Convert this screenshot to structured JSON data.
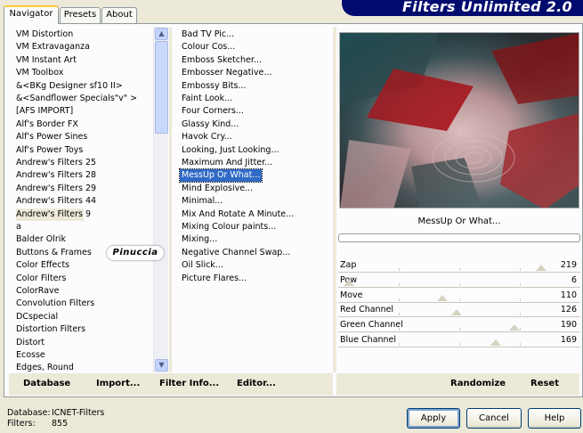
{
  "window": {
    "banner_title": "Filters Unlimited 2.0"
  },
  "tabs": [
    {
      "label": "Navigator",
      "active": true
    },
    {
      "label": "Presets",
      "active": false
    },
    {
      "label": "About",
      "active": false
    }
  ],
  "categories": {
    "selected": "Andrew's Filters 9",
    "items": [
      "VM Distortion",
      "VM Extravaganza",
      "VM Instant Art",
      "VM Toolbox",
      "&<BKg Designer sf10 II>",
      "&<Sandflower Specials\"v\" >",
      "[AFS IMPORT]",
      "Alf's Border FX",
      "Alf's Power Sines",
      "Alf's Power Toys",
      "Andrew's Filters 25",
      "Andrew's Filters 28",
      "Andrew's Filters 29",
      "Andrew's Filters 44",
      "Andrew's Filters 9",
      "a",
      "Balder Olrik",
      "Buttons & Frames",
      "Color Effects",
      "Color Filters",
      "ColorRave",
      "Convolution Filters",
      "DCspecial",
      "Distortion Filters",
      "Distort",
      "Ecosse",
      "Edges, Round"
    ]
  },
  "filters": {
    "selected": "MessUp Or What...",
    "items": [
      "Bad TV Pic...",
      "Colour Cos...",
      "Emboss Sketcher...",
      "Embosser Negative...",
      "Embossy Bits...",
      "Faint Look...",
      "Four Corners...",
      "Glassy Kind...",
      "Havok Cry...",
      "Looking, Just Looking...",
      "Maximum And Jitter...",
      "MessUp Or What...",
      "Mind Explosive...",
      "Minimal...",
      "Mix And Rotate A Minute...",
      "Mixing Colour paints...",
      "Mixing...",
      "Negative Channel Swap...",
      "Oil Slick...",
      "Picture Flares..."
    ]
  },
  "preview": {
    "filter_name": "MessUp Or What..."
  },
  "sliders": [
    {
      "label": "Zap",
      "value": 219
    },
    {
      "label": "Pow",
      "value": 6
    },
    {
      "label": "Move",
      "value": 110
    },
    {
      "label": "Red Channel",
      "value": 126
    },
    {
      "label": "Green Channel",
      "value": 190
    },
    {
      "label": "Blue Channel",
      "value": 169
    }
  ],
  "left_buttons": {
    "database": "Database",
    "import": "Import...",
    "filter_info": "Filter Info...",
    "editor": "Editor..."
  },
  "right_buttons": {
    "randomize": "Randomize",
    "reset": "Reset"
  },
  "watermark": "Pinuccia",
  "status": {
    "database_label": "Database:",
    "database_value": "ICNET-Filters",
    "filters_label": "Filters:",
    "filters_value": "855"
  },
  "dialog_buttons": {
    "apply": "Apply",
    "cancel": "Cancel",
    "help": "Help"
  },
  "colors": {
    "selection": "#316ac5",
    "banner": "#000b6e",
    "tab_accent": "#ffc83c"
  }
}
